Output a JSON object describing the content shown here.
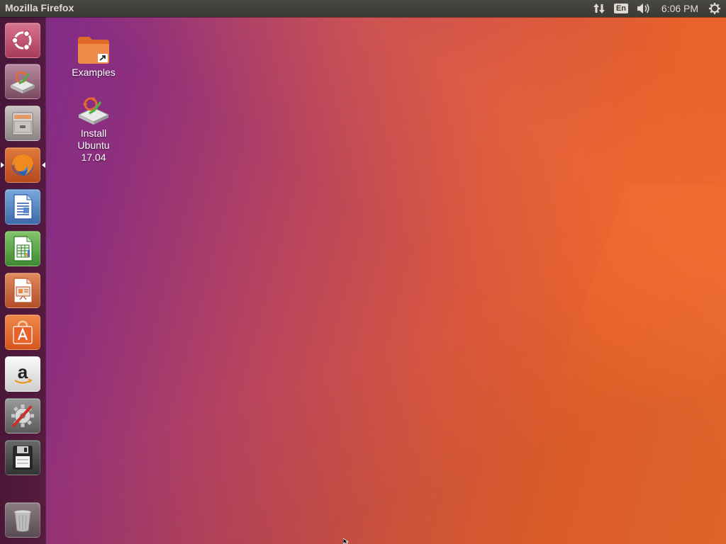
{
  "top_panel": {
    "app_title": "Mozilla Firefox",
    "keyboard_layout": "En",
    "clock": "6:06 PM",
    "icons": [
      "network-updown-icon",
      "keyboard-layout-icon",
      "volume-icon",
      "session-gear-icon"
    ]
  },
  "launcher": {
    "items": [
      {
        "name": "dash-home",
        "icon": "ubuntu-logo-icon",
        "color": "#c2536f"
      },
      {
        "name": "install-ubuntu",
        "icon": "installer-icon",
        "color": "#a86a8a"
      },
      {
        "name": "files",
        "icon": "file-cabinet-icon",
        "color": "#b0a8a8"
      },
      {
        "name": "firefox",
        "icon": "firefox-icon",
        "color": "#d0602a",
        "active": true
      },
      {
        "name": "libreoffice-writer",
        "icon": "writer-document-icon",
        "color": "#4a79b8"
      },
      {
        "name": "libreoffice-calc",
        "icon": "calc-spreadsheet-icon",
        "color": "#4f9a3a"
      },
      {
        "name": "libreoffice-impress",
        "icon": "impress-presentation-icon",
        "color": "#c55a32"
      },
      {
        "name": "ubuntu-software",
        "icon": "software-bag-icon",
        "color": "#e0682c"
      },
      {
        "name": "amazon",
        "icon": "amazon-icon",
        "color": "#e8e8e8"
      },
      {
        "name": "system-settings",
        "icon": "settings-wrench-gear-icon",
        "color": "#8a8a8a"
      },
      {
        "name": "removable-drive",
        "icon": "floppy-disk-icon",
        "color": "#555"
      },
      {
        "name": "trash",
        "icon": "trash-icon",
        "color": "#7a6a70"
      }
    ]
  },
  "desktop": {
    "icons": [
      {
        "label": "Examples",
        "icon": "folder-link-icon"
      },
      {
        "label_lines": [
          "Install",
          "Ubuntu",
          "17.04"
        ],
        "icon": "installer-icon"
      }
    ]
  },
  "colors": {
    "panel": "#3c3b37",
    "wallpaper_start": "#7b2a8b",
    "wallpaper_end": "#ec6a2e"
  }
}
